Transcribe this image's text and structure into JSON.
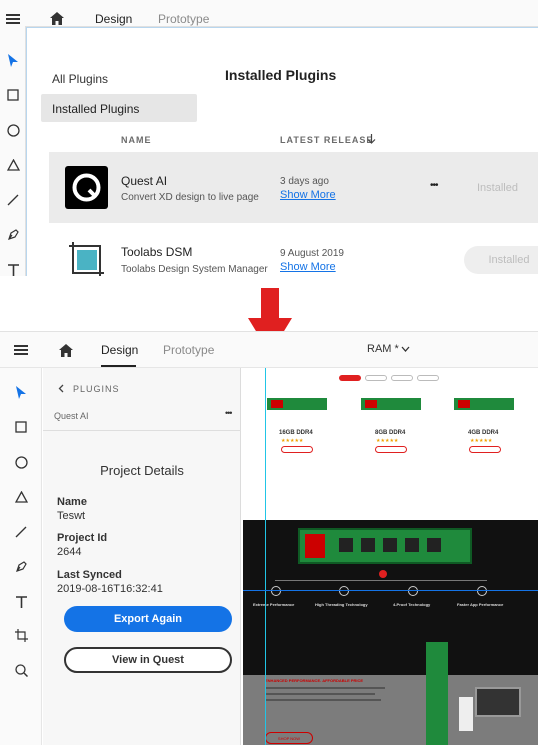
{
  "top": {
    "tabs": {
      "design": "Design",
      "prototype": "Prototype"
    },
    "nav": {
      "all_plugins": "All Plugins",
      "installed_plugins": "Installed Plugins"
    },
    "title": "Installed Plugins",
    "columns": {
      "name": "NAME",
      "latest_release": "LATEST RELEASE"
    },
    "plugins": [
      {
        "name": "Quest AI",
        "description": "Convert XD design to live page",
        "date": "3 days ago",
        "link": "Show More",
        "status": "Installed"
      },
      {
        "name": "Toolabs DSM",
        "description": "Toolabs Design System Manager",
        "date": "9 August 2019",
        "link": "Show More",
        "status": "Installed"
      }
    ],
    "more_dots": "•••"
  },
  "bottom": {
    "tabs": {
      "design": "Design",
      "prototype": "Prototype"
    },
    "document_title": "RAM *",
    "plugins_back": "PLUGINS",
    "plugin_name": "Quest AI",
    "more_dots": "•••",
    "project_details_title": "Project Details",
    "fields": {
      "name_label": "Name",
      "name_value": "Teswt",
      "project_id_label": "Project Id",
      "project_id_value": "2644",
      "last_synced_label": "Last Synced",
      "last_synced_value": "2019-08-16T16:32:41"
    },
    "buttons": {
      "export_again": "Export Again",
      "view_in_quest": "View in Quest"
    }
  },
  "canvas_art": {
    "products": [
      "16GB DDR4",
      "8GB DDR4",
      "4GB DDR4"
    ],
    "features": [
      "Extreme Performance",
      "High Threading Technology",
      "4-Proof Technology",
      "Faster App Performance"
    ],
    "headline": "ENHANCED PERFORMANCE. AFFORDABLE PRICE",
    "cta": "SHOP NOW"
  },
  "colors": {
    "accent": "#1473e6",
    "arrow": "#e02020",
    "ram_green": "#1f8a3c"
  }
}
